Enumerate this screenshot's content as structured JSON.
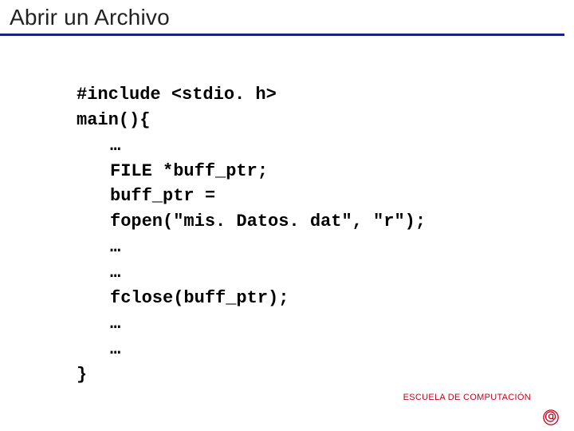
{
  "title": "Abrir un Archivo",
  "code": {
    "l1": "#include <stdio. h>",
    "l2": "main(){",
    "l3": "…",
    "l4": "FILE *buff_ptr;",
    "l5": "buff_ptr =",
    "l6": "fopen(\"mis. Datos. dat\", \"r\");",
    "l7": "…",
    "l8": "…",
    "l9": "fclose(buff_ptr);",
    "l10": "…",
    "l11": "…",
    "l12": "}"
  },
  "footer": "ESCUELA DE COMPUTACIÓN",
  "logo_name": "at-logo"
}
